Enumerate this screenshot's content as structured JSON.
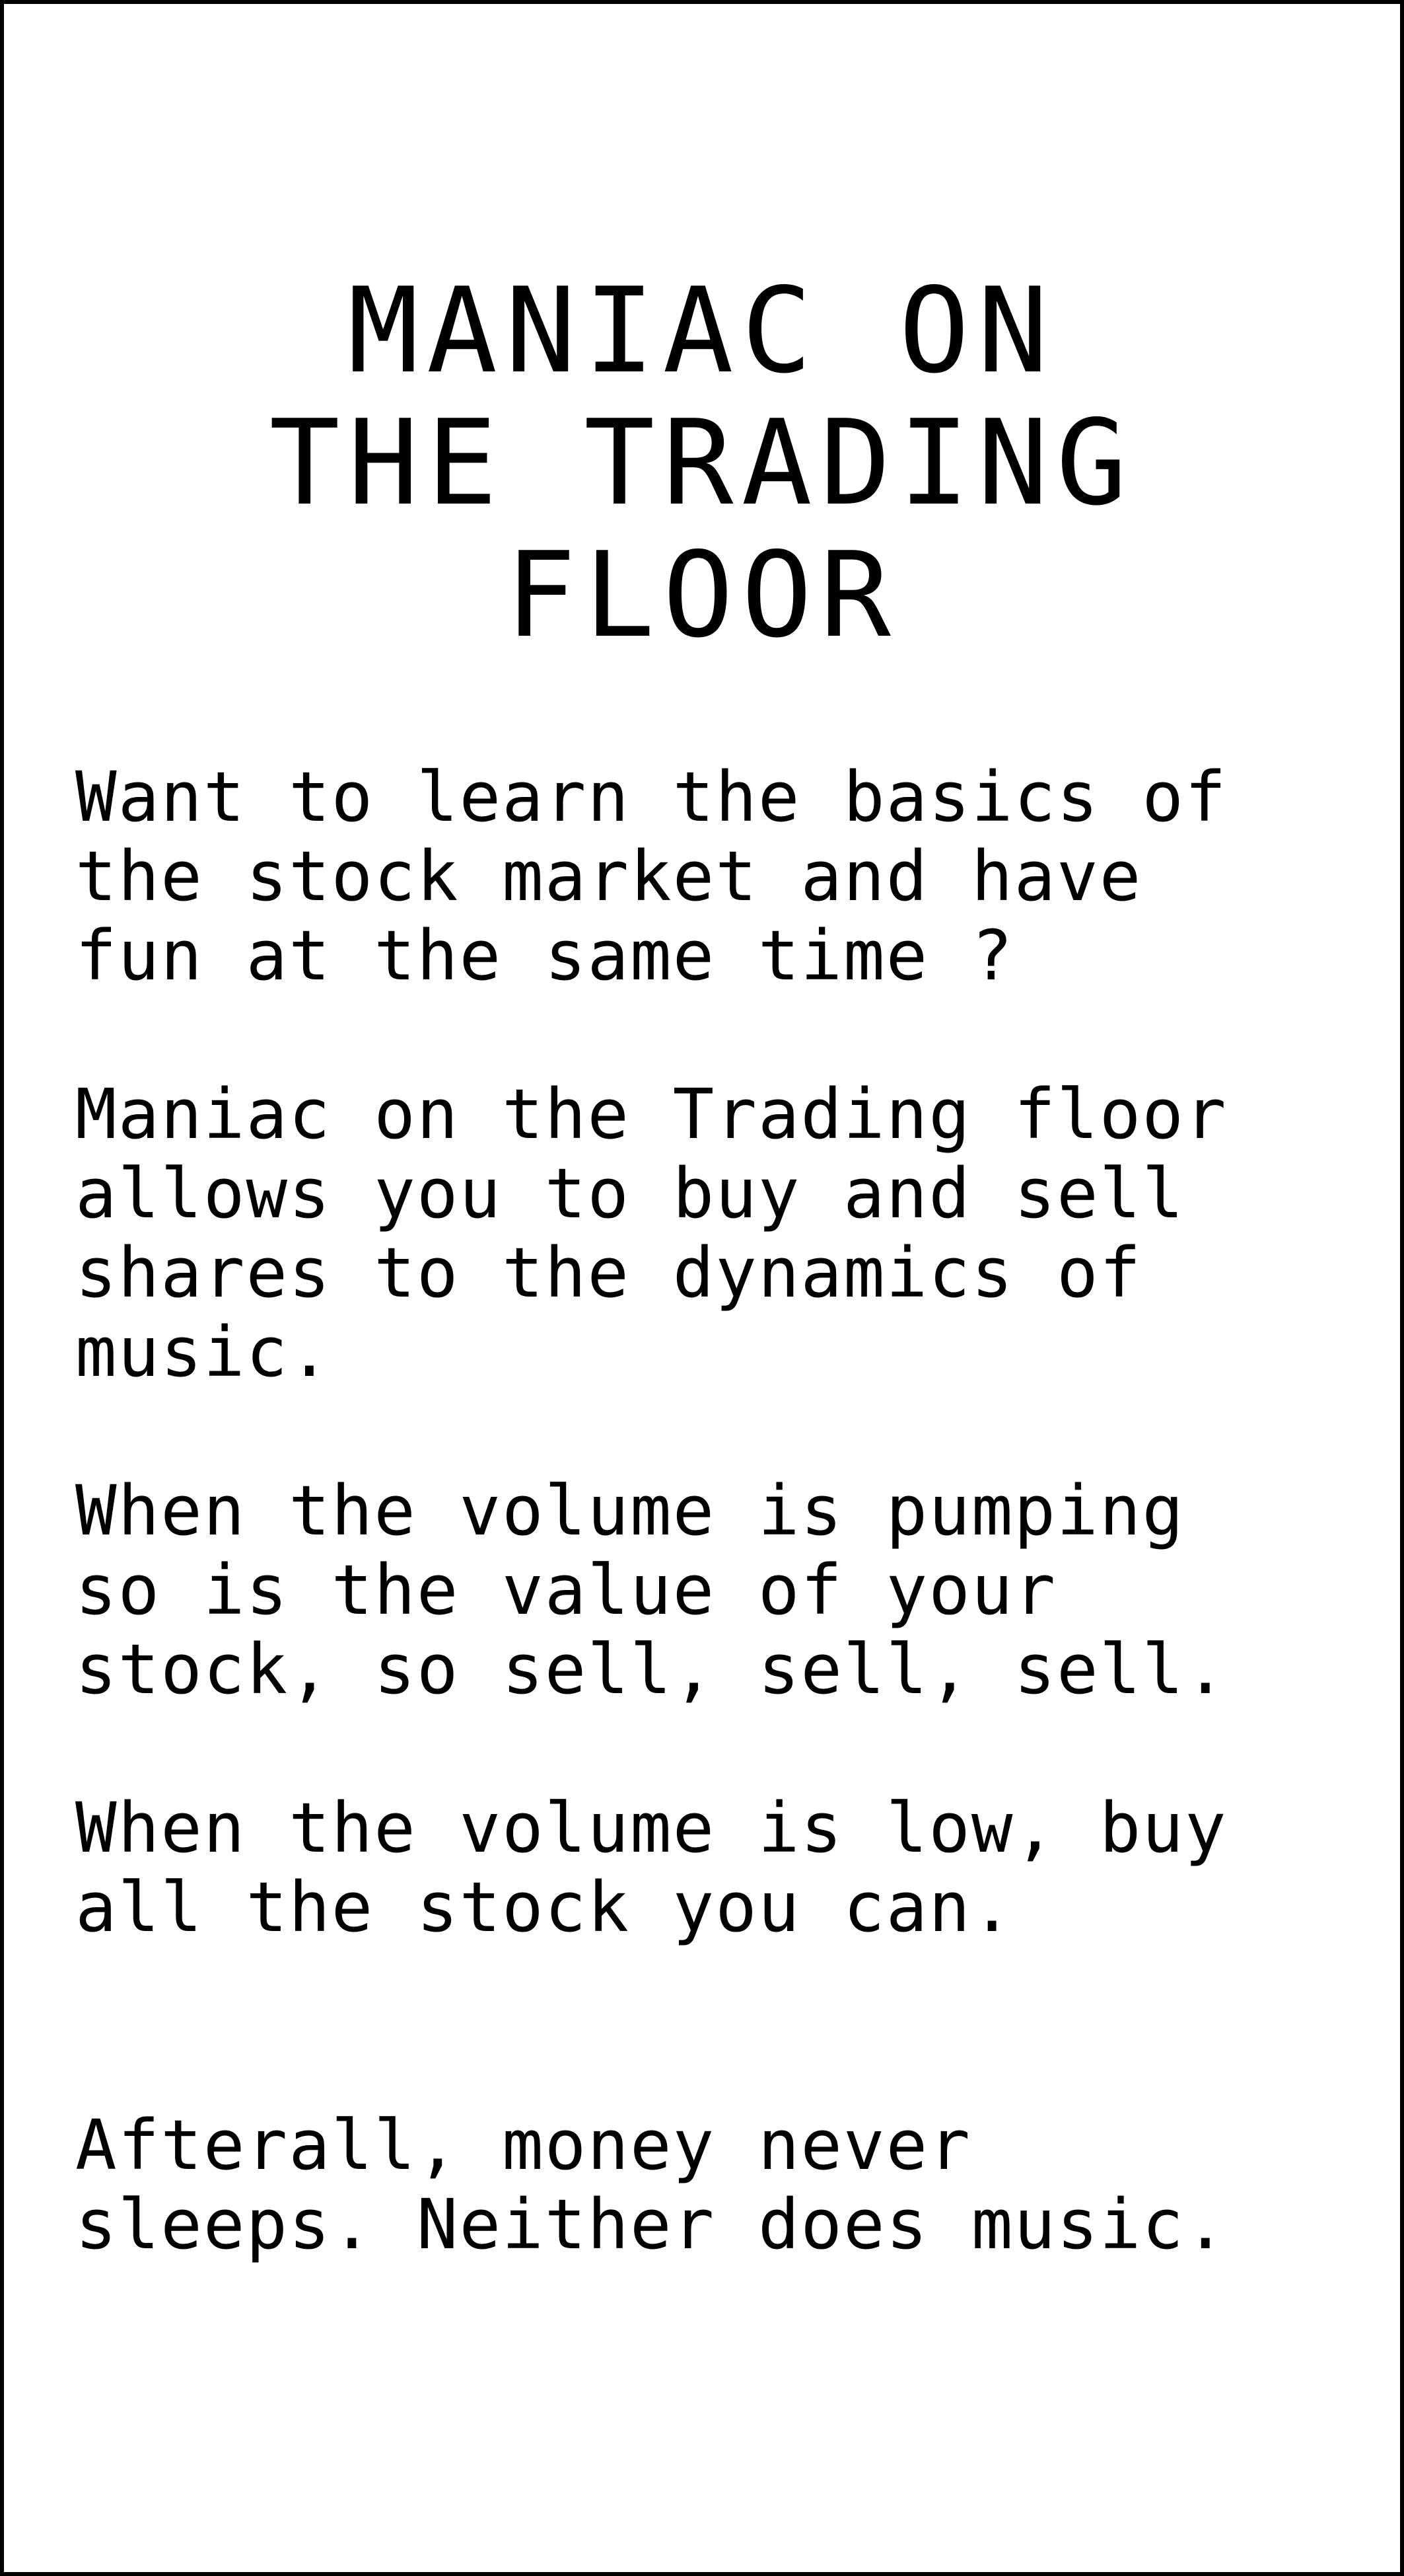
{
  "title": {
    "lines": [
      "MANIAC ON",
      "THE TRADING",
      "FLOOR"
    ]
  },
  "paragraphs": [
    {
      "lines": [
        "Want to learn the basics of",
        "the stock market and have",
        "fun at the same time ?"
      ]
    },
    {
      "lines": [
        "Maniac on the Trading floor",
        "allows you to buy and sell",
        "shares to the dynamics of",
        "music."
      ]
    },
    {
      "lines": [
        "When the volume is pumping",
        "so is the value of your",
        "stock, so sell, sell, sell."
      ]
    },
    {
      "lines": [
        "When the volume is low, buy",
        "all the stock you can."
      ]
    },
    {
      "lines": [
        "",
        "Afterall, money never",
        "sleeps. Neither does music."
      ]
    }
  ]
}
